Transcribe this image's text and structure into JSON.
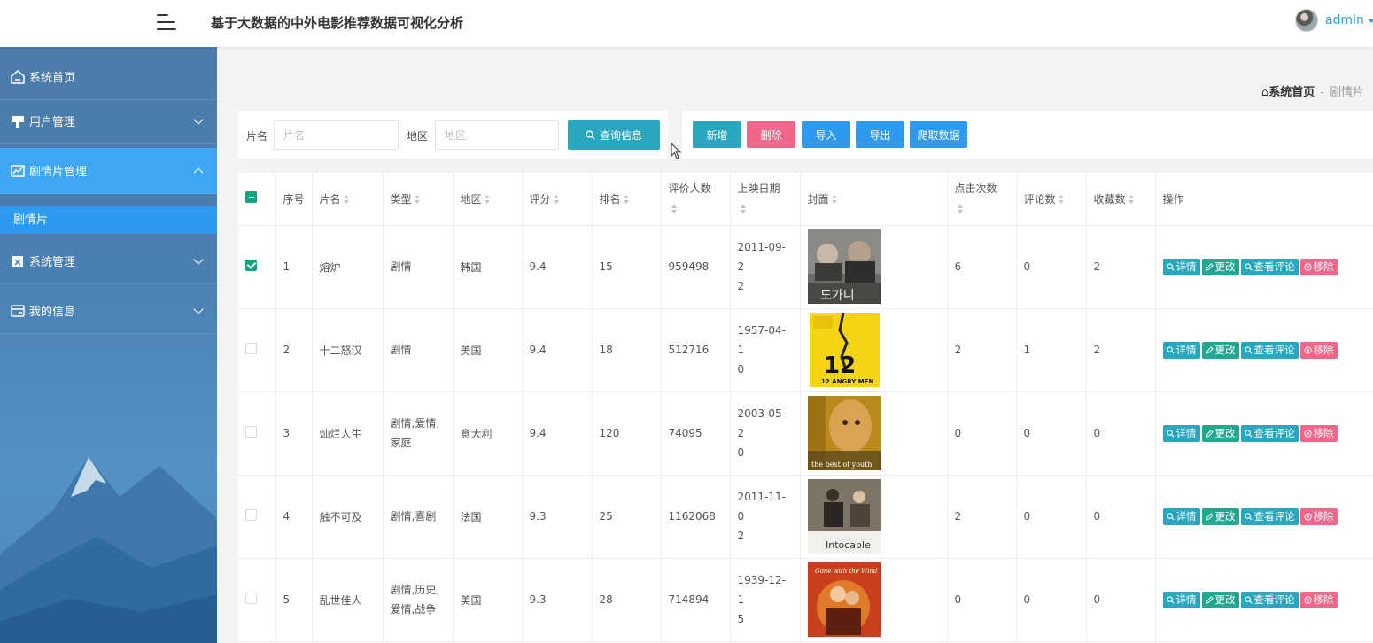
{
  "header": {
    "title": "基于大数据的中外电影推荐数据可视化分析",
    "user": "admin"
  },
  "sidebar": {
    "items": [
      {
        "label": "系统首页",
        "icon": "home-icon"
      },
      {
        "label": "用户管理",
        "icon": "user-icon"
      },
      {
        "label": "剧情片管理",
        "icon": "chart-icon"
      },
      {
        "label": "系统管理",
        "icon": "clipboard-icon"
      },
      {
        "label": "我的信息",
        "icon": "card-icon"
      }
    ],
    "sub_item": "剧情片"
  },
  "breadcrumb": {
    "home": "系统首页",
    "separator": "-",
    "current": "剧情片"
  },
  "search": {
    "name_label": "片名",
    "name_placeholder": "片名",
    "region_label": "地区",
    "region_placeholder": "地区",
    "button": "查询信息"
  },
  "actions": {
    "add": "新增",
    "delete": "删除",
    "import": "导入",
    "export": "导出",
    "crawl": "爬取数据"
  },
  "table": {
    "headers": {
      "index": "序号",
      "name": "片名",
      "type": "类型",
      "region": "地区",
      "score": "评分",
      "rank": "排名",
      "raters": "评价人数",
      "release": "上映日期",
      "cover": "封面",
      "clicks": "点击次数",
      "comments": "评论数",
      "favorites": "收藏数",
      "ops": "操作"
    },
    "op_labels": {
      "detail": "详情",
      "edit": "更改",
      "comment": "查看评论",
      "remove": "移除"
    },
    "rows": [
      {
        "index": "1",
        "name": "熔炉",
        "type_l1": "剧情",
        "type_l2": "",
        "region": "韩国",
        "score": "9.4",
        "rank": "15",
        "raters": "959498",
        "release_l1": "2011-09-2",
        "release_l2": "2",
        "clicks": "6",
        "comments": "0",
        "favorites": "2",
        "checked": true
      },
      {
        "index": "2",
        "name": "十二怒汉",
        "type_l1": "剧情",
        "type_l2": "",
        "region": "美国",
        "score": "9.4",
        "rank": "18",
        "raters": "512716",
        "release_l1": "1957-04-1",
        "release_l2": "0",
        "clicks": "2",
        "comments": "1",
        "favorites": "2",
        "checked": false
      },
      {
        "index": "3",
        "name": "灿烂人生",
        "type_l1": "剧情,爱情,",
        "type_l2": "家庭",
        "region": "意大利",
        "score": "9.4",
        "rank": "120",
        "raters": "74095",
        "release_l1": "2003-05-2",
        "release_l2": "0",
        "clicks": "0",
        "comments": "0",
        "favorites": "0",
        "checked": false
      },
      {
        "index": "4",
        "name": "触不可及",
        "type_l1": "剧情,喜剧",
        "type_l2": "",
        "region": "法国",
        "score": "9.3",
        "rank": "25",
        "raters": "1162068",
        "release_l1": "2011-11-0",
        "release_l2": "2",
        "clicks": "2",
        "comments": "0",
        "favorites": "0",
        "checked": false
      },
      {
        "index": "5",
        "name": "乱世佳人",
        "type_l1": "剧情,历史,",
        "type_l2": "爱情,战争",
        "region": "美国",
        "score": "9.3",
        "rank": "28",
        "raters": "714894",
        "release_l1": "1939-12-1",
        "release_l2": "5",
        "clicks": "0",
        "comments": "0",
        "favorites": "0",
        "checked": false
      }
    ],
    "poster_texts": {
      "angry_men": "12 ANGRY MEN",
      "best_of_youth": "the best of youth",
      "intocable": "Intocable"
    }
  },
  "colors": {
    "accent_blue": "#2f9fd8",
    "teal": "#2aa6bf",
    "green": "#22a891",
    "pink": "#f0678a",
    "sidebar_active": "#3ea6f2"
  }
}
